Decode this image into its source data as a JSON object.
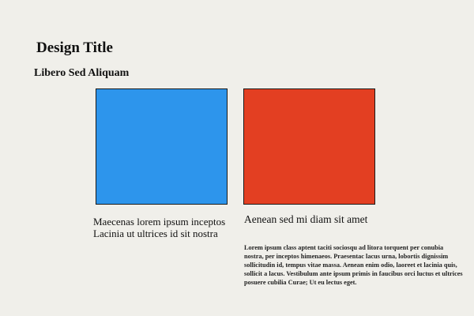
{
  "header": {
    "title": "Design Title",
    "subtitle": "Libero Sed Aliquam"
  },
  "swatches": {
    "left": {
      "color": "#2d95ec"
    },
    "right": {
      "color": "#e33f22"
    }
  },
  "captions": {
    "left_line1": "Maecenas lorem ipsum inceptos",
    "left_line2": "Lacinia ut ultrices id sit nostra",
    "right": "Aenean sed mi diam sit amet"
  },
  "body": {
    "paragraph": "Lorem ipsum class aptent taciti sociosqu ad litora torquent per conubia nostra, per inceptos himenaeos. Praesentac lacus urna, lobortis dignissim sollicitudin id, tempus vitae massa. Aenean enim odio, laoreet et lacinia quis, sollicit a lacus. Vestibulum ante ipsum primis in faucibus orci luctus et ultrices posuere cubilia Curae; Ut eu lectus eget."
  }
}
